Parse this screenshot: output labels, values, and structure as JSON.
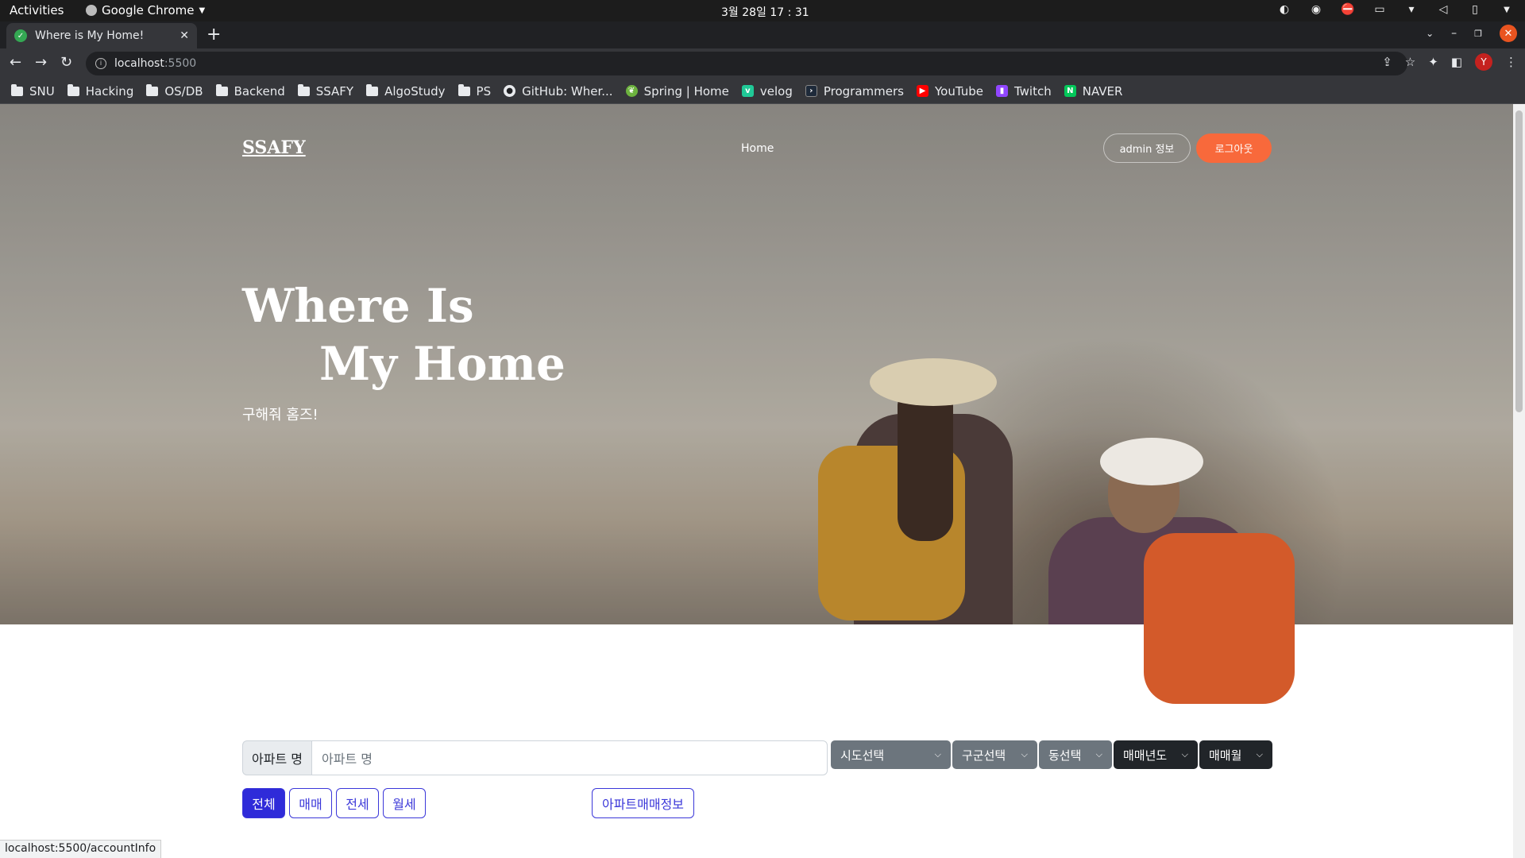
{
  "os": {
    "activities": "Activities",
    "app_name": "Google Chrome",
    "clock": "3월 28일  17 : 31"
  },
  "browser": {
    "tab_title": "Where is My Home!",
    "url_host": "localhost",
    "url_port": ":5500",
    "profile_initial": "Y",
    "bookmarks": [
      {
        "label": "SNU",
        "type": "folder"
      },
      {
        "label": "Hacking",
        "type": "folder"
      },
      {
        "label": "OS/DB",
        "type": "folder"
      },
      {
        "label": "Backend",
        "type": "folder"
      },
      {
        "label": "SSAFY",
        "type": "folder"
      },
      {
        "label": "AlgoStudy",
        "type": "folder"
      },
      {
        "label": "PS",
        "type": "folder"
      },
      {
        "label": "GitHub: Wher...",
        "type": "github"
      },
      {
        "label": "Spring | Home",
        "type": "spring"
      },
      {
        "label": "velog",
        "type": "velog"
      },
      {
        "label": "Programmers",
        "type": "programmers"
      },
      {
        "label": "YouTube",
        "type": "youtube"
      },
      {
        "label": "Twitch",
        "type": "twitch"
      },
      {
        "label": "NAVER",
        "type": "naver"
      }
    ],
    "status_url": "localhost:5500/accountInfo"
  },
  "page": {
    "brand": "SSAFY",
    "nav_home": "Home",
    "admin_button": "admin 정보",
    "logout_button": "로그아웃",
    "headline_line1": "Where Is",
    "headline_line2": "My Home",
    "subline": "구해줘 홈즈!"
  },
  "search": {
    "apt_label": "아파트 명",
    "apt_placeholder": "아파트 명",
    "sido": "시도선택",
    "gugun": "구군선택",
    "dong": "동선택",
    "year": "매매년도",
    "month": "매매월"
  },
  "filters": {
    "all": "전체",
    "sale": "매매",
    "jeonse": "전세",
    "monthly": "월세",
    "apt_info": "아파트매매정보"
  }
}
